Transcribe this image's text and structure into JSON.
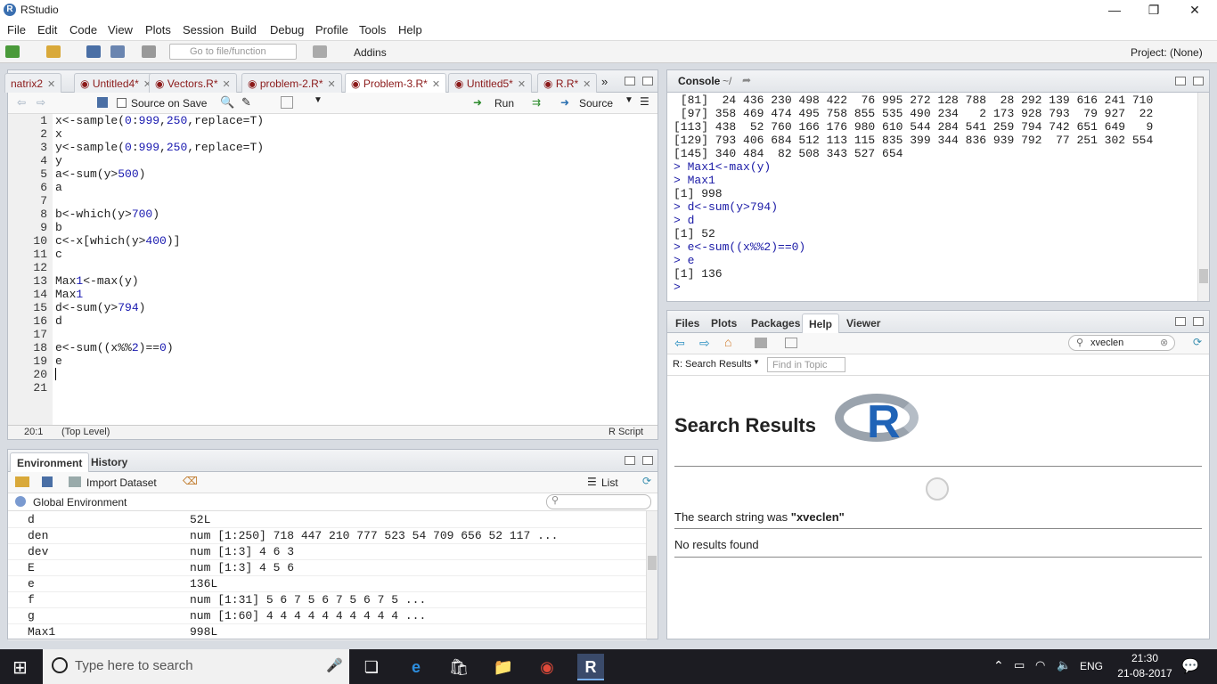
{
  "window": {
    "title": "RStudio"
  },
  "menu": [
    "File",
    "Edit",
    "Code",
    "View",
    "Plots",
    "Session",
    "Build",
    "Debug",
    "Profile",
    "Tools",
    "Help"
  ],
  "toolbar": {
    "goto_placeholder": "Go to file/function",
    "addins": "Addins",
    "project": "Project: (None)"
  },
  "editor": {
    "tabs": [
      {
        "label": "natrix2"
      },
      {
        "label": "Untitled4*"
      },
      {
        "label": "Vectors.R*"
      },
      {
        "label": "problem-2.R*"
      },
      {
        "label": "Problem-3.R*",
        "active": true
      },
      {
        "label": "Untitled5*"
      },
      {
        "label": "R.R*"
      }
    ],
    "source_on_save": "Source on Save",
    "run": "Run",
    "source": "Source",
    "lines": [
      "x<-sample(0:999,250,replace=T)",
      "x",
      "y<-sample(0:999,250,replace=T)",
      "y",
      "a<-sum(y>500)",
      "a",
      "",
      "b<-which(y>700)",
      "b",
      "c<-x[which(y>400)]",
      "c",
      "",
      "Max1<-max(y)",
      "Max1",
      "d<-sum(y>794)",
      "d",
      "",
      "e<-sum((x%%2)==0)",
      "e",
      "",
      ""
    ],
    "cursor_pos": "20:1",
    "scope": "(Top Level)",
    "filetype": "R Script"
  },
  "console": {
    "title": "Console",
    "path": "~/",
    "lines": [
      " [81]  24 436 230 498 422  76 995 272 128 788  28 292 139 616 241 710",
      " [97] 358 469 474 495 758 855 535 490 234   2 173 928 793  79 927  22",
      "[113] 438  52 760 166 176 980 610 544 284 541 259 794 742 651 649   9",
      "[129] 793 406 684 512 113 115 835 399 344 836 939 792  77 251 302 554",
      "[145] 340 484  82 508 343 527 654",
      "> Max1<-max(y)",
      "> Max1",
      "[1] 998",
      "> d<-sum(y>794)",
      "> d",
      "[1] 52",
      "> e<-sum((x%%2)==0)",
      "> e",
      "[1] 136",
      "> "
    ]
  },
  "environment": {
    "tabs": [
      "Environment",
      "History"
    ],
    "import": "Import Dataset",
    "view_mode": "List",
    "scope": "Global Environment",
    "rows": [
      {
        "name": "d",
        "value": "52L"
      },
      {
        "name": "den",
        "value": "num [1:250] 718 447 210 777 523 54 709 656 52 117 ..."
      },
      {
        "name": "dev",
        "value": "num [1:3] 4 6 3"
      },
      {
        "name": "E",
        "value": "num [1:3] 4 5 6"
      },
      {
        "name": "e",
        "value": "136L"
      },
      {
        "name": "f",
        "value": "num [1:31] 5 6 7 5 6 7 5 6 7 5 ..."
      },
      {
        "name": "g",
        "value": "num [1:60] 4 4 4 4 4 4 4 4 4 4 ..."
      },
      {
        "name": "Max1",
        "value": "998L"
      }
    ]
  },
  "help": {
    "tabs": [
      "Files",
      "Plots",
      "Packages",
      "Help",
      "Viewer"
    ],
    "search_value": "xveclen",
    "results_dropdown": "R: Search Results",
    "find_placeholder": "Find in Topic",
    "heading": "Search Results",
    "search_string_prefix": "The search string was ",
    "search_string": "\"xveclen\"",
    "no_results": "No results found"
  },
  "taskbar": {
    "search_placeholder": "Type here to search",
    "lang": "ENG",
    "time": "21:30",
    "date": "21-08-2017"
  },
  "colors": {
    "accent": "#3a6fb0",
    "tab_text": "#8b1a1a",
    "prompt": "#1a1aa6",
    "taskbar": "#1c1c22"
  }
}
